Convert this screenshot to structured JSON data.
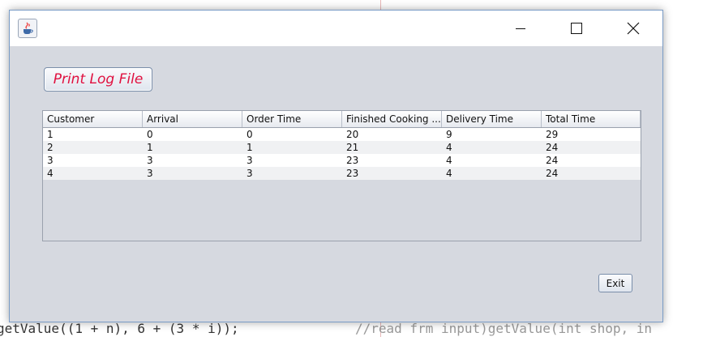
{
  "background_code": {
    "line_bottom_left": "getValue((1 + n), 6 + (3 * i));",
    "line_bottom_right": "//read frm input)getValue(int shop, in"
  },
  "window": {
    "icons": {
      "app": "java-cup-icon",
      "minimize": "minimize-icon",
      "maximize": "maximize-icon",
      "close": "close-icon"
    }
  },
  "toolbar": {
    "print_label": "Print Log File",
    "exit_label": "Exit"
  },
  "table": {
    "columns": [
      "Customer",
      "Arrival",
      "Order Time",
      "Finished Cooking ...",
      "Delivery Time",
      "Total Time"
    ],
    "rows": [
      [
        "1",
        "0",
        "0",
        "20",
        "9",
        "29"
      ],
      [
        "2",
        "1",
        "1",
        "21",
        "4",
        "24"
      ],
      [
        "3",
        "3",
        "3",
        "23",
        "4",
        "24"
      ],
      [
        "4",
        "3",
        "3",
        "23",
        "4",
        "24"
      ]
    ]
  },
  "colors": {
    "print_text": "#e0103f",
    "window_bg": "#d6d9e0"
  }
}
